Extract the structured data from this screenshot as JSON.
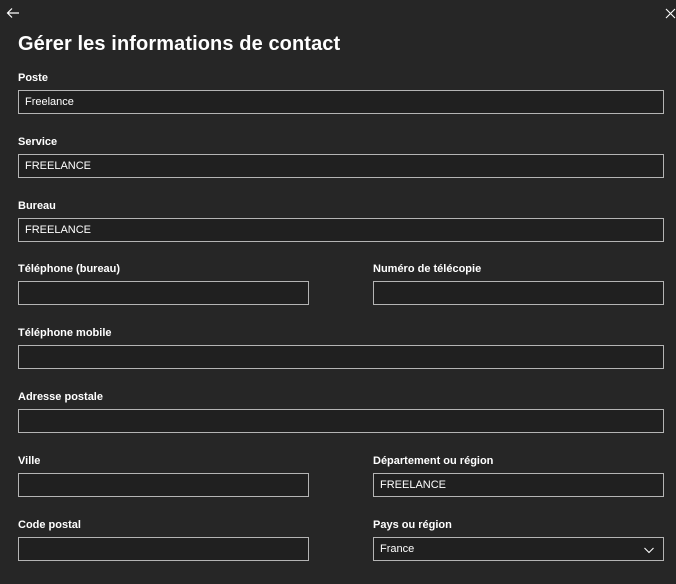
{
  "header": {
    "back_icon": "arrow-left-icon",
    "close_icon": "close-icon",
    "title": "Gérer les informations de contact"
  },
  "form": {
    "poste": {
      "label": "Poste",
      "value": "Freelance"
    },
    "service": {
      "label": "Service",
      "value": "FREELANCE"
    },
    "bureau": {
      "label": "Bureau",
      "value": "FREELANCE"
    },
    "telephone_bureau": {
      "label": "Téléphone (bureau)",
      "value": ""
    },
    "fax": {
      "label": "Numéro de télécopie",
      "value": ""
    },
    "mobile": {
      "label": "Téléphone mobile",
      "value": ""
    },
    "adresse": {
      "label": "Adresse postale",
      "value": ""
    },
    "ville": {
      "label": "Ville",
      "value": ""
    },
    "departement": {
      "label": "Département ou région",
      "value": "FREELANCE"
    },
    "code_postal": {
      "label": "Code postal",
      "value": ""
    },
    "pays": {
      "label": "Pays ou région",
      "value": "France",
      "icon": "chevron-down-icon"
    }
  },
  "colors": {
    "background": "#262626",
    "field_border": "#b4b4b4",
    "text": "#ffffff"
  }
}
